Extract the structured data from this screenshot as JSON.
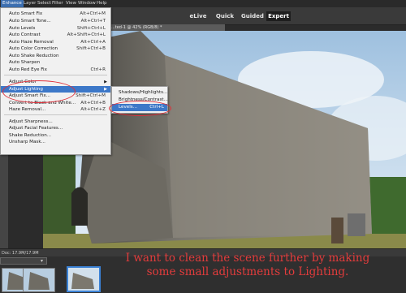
{
  "menubar": {
    "items": [
      "Enhance",
      "Layer",
      "Select",
      "Filter",
      "View",
      "Window",
      "Help"
    ]
  },
  "modes": {
    "elive": "eLive",
    "quick": "Quick",
    "guided": "Guided",
    "expert": "Expert"
  },
  "document": {
    "tab_title": "...ted-1 @ 42% (RGB/8) *"
  },
  "enhance_menu": {
    "items": [
      {
        "label": "Auto Smart Fix",
        "shortcut": "Alt+Ctrl+M"
      },
      {
        "label": "Auto Smart Tone...",
        "shortcut": "Alt+Ctrl+T"
      },
      {
        "label": "Auto Levels",
        "shortcut": "Shift+Ctrl+L"
      },
      {
        "label": "Auto Contrast",
        "shortcut": "Alt+Shift+Ctrl+L"
      },
      {
        "label": "Auto Haze Removal",
        "shortcut": "Alt+Ctrl+A"
      },
      {
        "label": "Auto Color Correction",
        "shortcut": "Shift+Ctrl+B"
      },
      {
        "label": "Auto Shake Reduction",
        "shortcut": ""
      },
      {
        "label": "Auto Sharpen",
        "shortcut": ""
      },
      {
        "label": "Auto Red Eye Fix",
        "shortcut": "Ctrl+R"
      },
      {
        "label": "Adjust Color",
        "shortcut": ""
      },
      {
        "label": "Adjust Lighting",
        "shortcut": ""
      },
      {
        "label": "Adjust Smart Fix...",
        "shortcut": "Shift+Ctrl+M"
      },
      {
        "label": "Convert to Black and White...",
        "shortcut": "Alt+Ctrl+B"
      },
      {
        "label": "Haze Removal...",
        "shortcut": "Alt+Ctrl+Z"
      },
      {
        "label": "Adjust Sharpness...",
        "shortcut": ""
      },
      {
        "label": "Adjust Facial Features...",
        "shortcut": ""
      },
      {
        "label": "Shake Reduction...",
        "shortcut": ""
      },
      {
        "label": "Unsharp Mask...",
        "shortcut": ""
      }
    ]
  },
  "lighting_menu": {
    "items": [
      {
        "label": "Shadows/Highlights...",
        "shortcut": ""
      },
      {
        "label": "Brightness/Contrast...",
        "shortcut": ""
      },
      {
        "label": "Levels...",
        "shortcut": "Ctrl+L"
      }
    ]
  },
  "status": {
    "doc_info": "Doc: 17.9M/17.9M"
  },
  "caption": {
    "line1": "I want to clean the scene further by making",
    "line2": "some small adjustments to Lighting."
  },
  "colors": {
    "highlight": "#3d78c8",
    "annotation": "#e0303a"
  }
}
